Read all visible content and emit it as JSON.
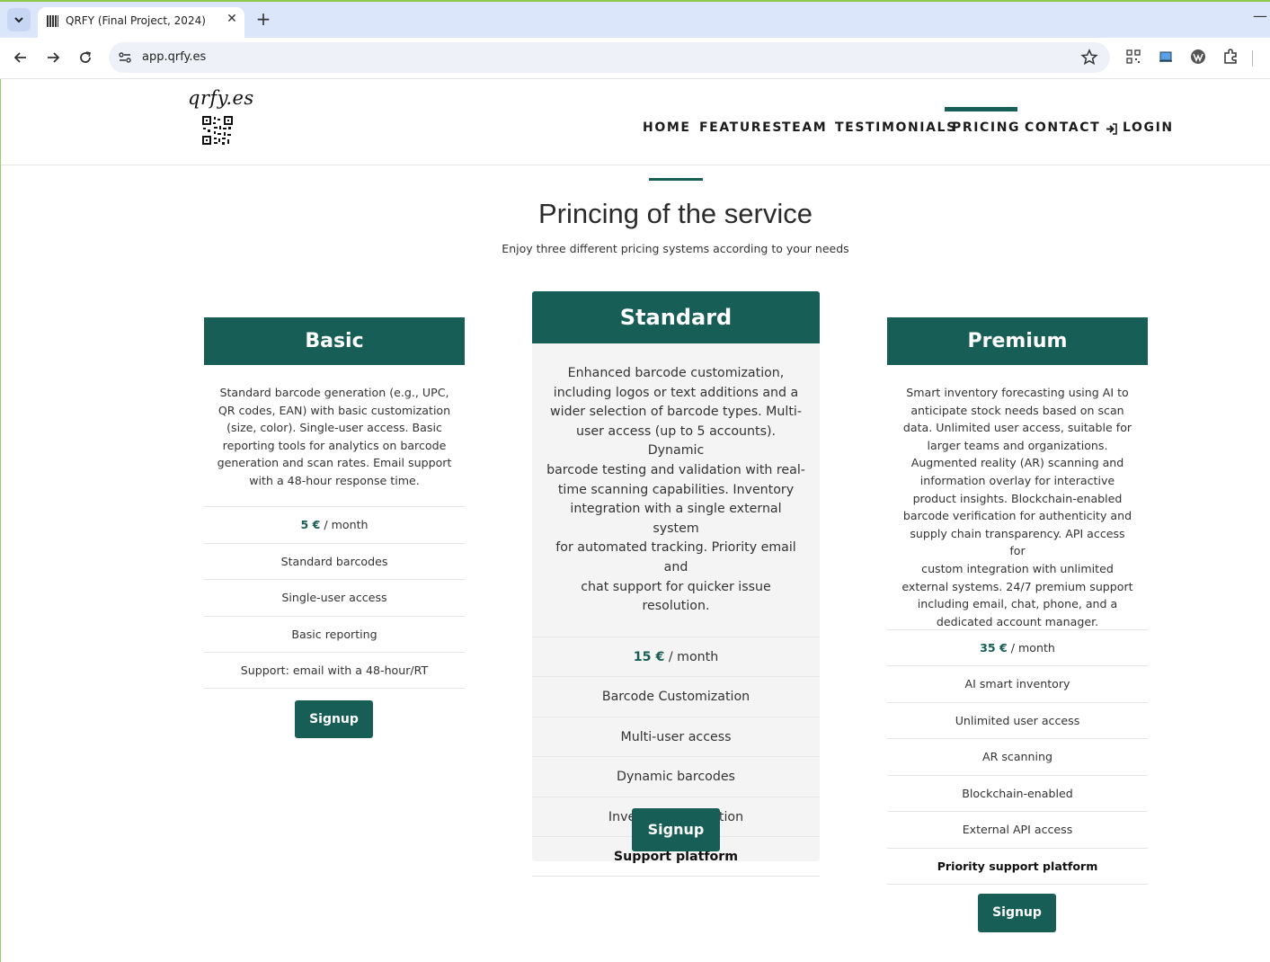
{
  "browser": {
    "tab_title": "QRFY (Final Project, 2024)",
    "tab_close": "✕",
    "new_tab": "+",
    "minimize": "—",
    "url": "app.qrfy.es"
  },
  "header": {
    "logo_text": "qrfy.es",
    "nav": [
      {
        "label": "HOME",
        "active": false
      },
      {
        "label": "FEATURES",
        "active": false
      },
      {
        "label": "TEAM",
        "active": false
      },
      {
        "label": "TESTIMONIALS",
        "active": false
      },
      {
        "label": "PRICING",
        "active": true
      },
      {
        "label": "CONTACT",
        "active": false
      },
      {
        "label": "LOGIN",
        "icon": "login-icon",
        "active": false
      }
    ]
  },
  "section": {
    "title": "Princing of the service",
    "subtitle": "Enjoy three different pricing systems according to your needs"
  },
  "plans": [
    {
      "name": "Basic",
      "description_lines": [
        "Standard barcode generation (e.g., UPC,",
        "QR codes, EAN) with basic customization",
        "(size, color). Single-user access. Basic",
        "reporting tools for analytics on barcode",
        "generation and scan rates. Email support",
        "with a 48-hour response time."
      ],
      "price": "5 €",
      "period": " / month",
      "features": [
        "Standard barcodes",
        "Single-user access",
        "Basic reporting",
        "Support: email with a 48-hour/RT"
      ],
      "signup": "Signup"
    },
    {
      "name": "Standard",
      "description_lines": [
        "Enhanced barcode customization,",
        "including logos or text additions and a",
        "wider selection of barcode types. Multi-",
        "user access (up to 5 accounts). Dynamic",
        "barcode testing and validation with real-",
        "time scanning capabilities. Inventory",
        "integration with a single external system",
        "for automated tracking. Priority email and",
        "chat support for quicker issue resolution."
      ],
      "price": "15 €",
      "period": " / month",
      "features": [
        "Barcode Customization",
        "Multi-user access",
        "Dynamic barcodes",
        "Inventory integration"
      ],
      "bold_feature": "Support platform",
      "signup": "Signup"
    },
    {
      "name": "Premium",
      "description_lines": [
        "Smart inventory forecasting using AI to",
        "anticipate stock needs based on scan",
        "data. Unlimited user access, suitable for",
        "larger teams and organizations.",
        "Augmented reality (AR) scanning and",
        "information overlay for interactive",
        "product insights. Blockchain-enabled",
        "barcode verification for authenticity and",
        "supply chain transparency. API access for",
        "custom integration with unlimited",
        "external systems. 24/7 premium support",
        "including email, chat, phone, and a",
        "dedicated account manager."
      ],
      "price": "35 €",
      "period": " / month",
      "features": [
        "AI smart inventory",
        "Unlimited user access",
        "AR scanning",
        "Blockchain-enabled",
        "External API access"
      ],
      "bold_feature": "Priority support platform",
      "signup": "Signup"
    }
  ],
  "colors": {
    "accent": "#175e56",
    "chrome": "#dbe6fb"
  }
}
